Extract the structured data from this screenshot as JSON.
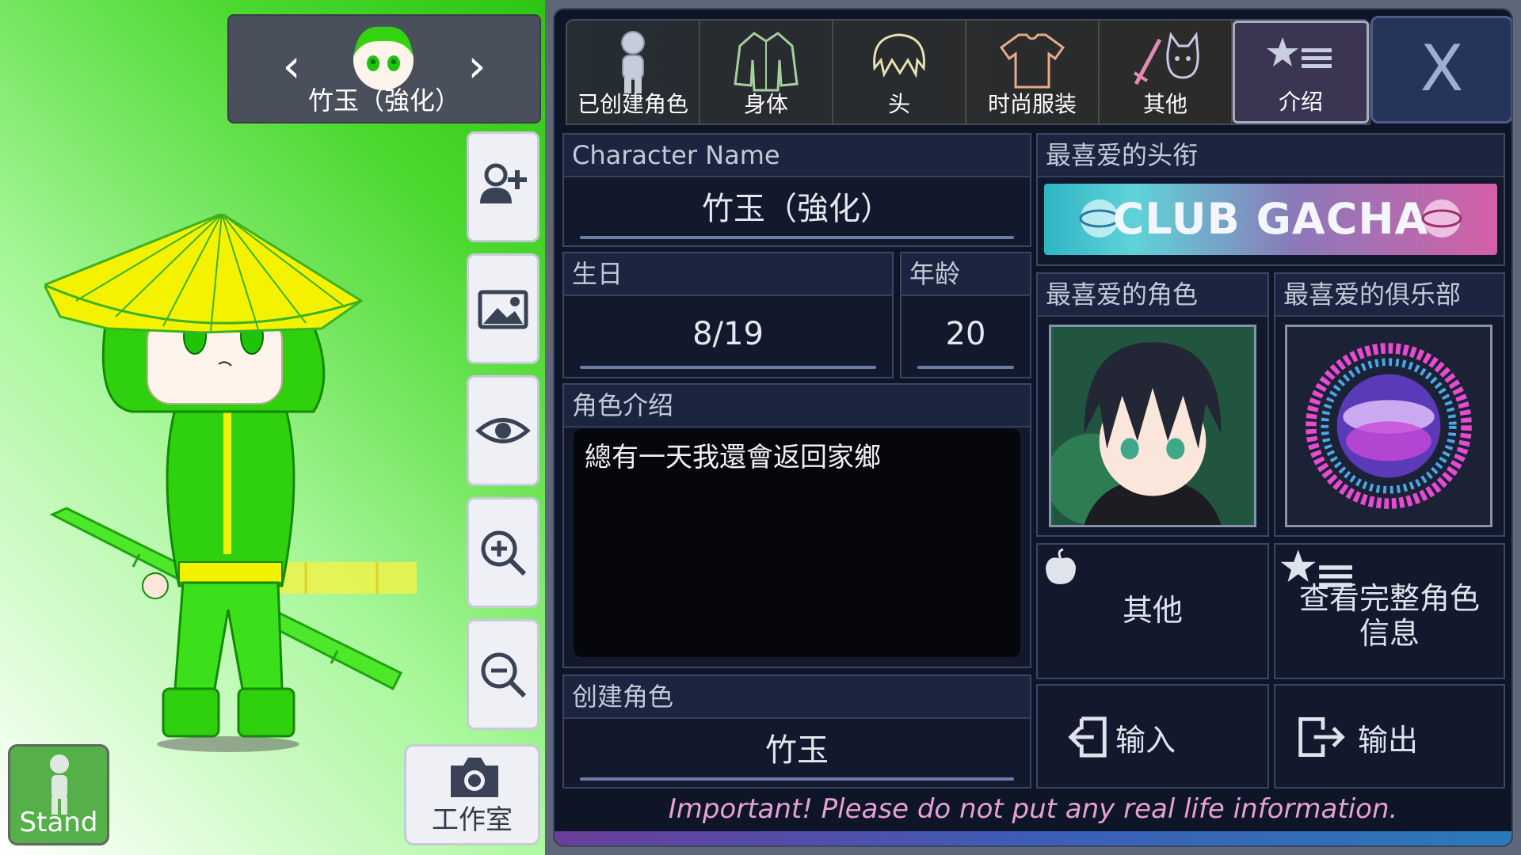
{
  "character_nav": {
    "name": "竹玉（強化）"
  },
  "stand_button": {
    "label": "Stand"
  },
  "studio_button": {
    "label": "工作室"
  },
  "tabs": [
    {
      "label": "已创建角色",
      "icon": "person-icon"
    },
    {
      "label": "身体",
      "icon": "jacket-icon"
    },
    {
      "label": "头",
      "icon": "hair-icon"
    },
    {
      "label": "时尚服装",
      "icon": "shirt-icon"
    },
    {
      "label": "其他",
      "icon": "sword-cat-icon"
    },
    {
      "label": "介绍",
      "icon": "star-list-icon"
    }
  ],
  "close_label": "X",
  "character_name": {
    "label": "Character Name",
    "value": "竹玉（強化）"
  },
  "birthday": {
    "label": "生日",
    "value": "8/19"
  },
  "age": {
    "label": "年龄",
    "value": "20"
  },
  "intro": {
    "label": "角色介绍",
    "value": "總有一天我還會返回家鄉"
  },
  "created_character": {
    "label": "创建角色",
    "value": "竹玉"
  },
  "favorite_title": {
    "label": "最喜爱的头衔",
    "value": "CLUB GACHA"
  },
  "favorite_character": {
    "label": "最喜爱的角色"
  },
  "favorite_club": {
    "label": "最喜爱的俱乐部"
  },
  "other_button": {
    "label": "其他"
  },
  "full_info_button": {
    "label": "查看完整角色信息"
  },
  "import_button": {
    "label": "输入"
  },
  "export_button": {
    "label": "输出"
  },
  "important_note": "Important! Please do not put any real life information.",
  "colors": {
    "accent_green": "#2dc514",
    "panel_bg": "#0d1527",
    "note_pink": "#e6a0d4"
  }
}
